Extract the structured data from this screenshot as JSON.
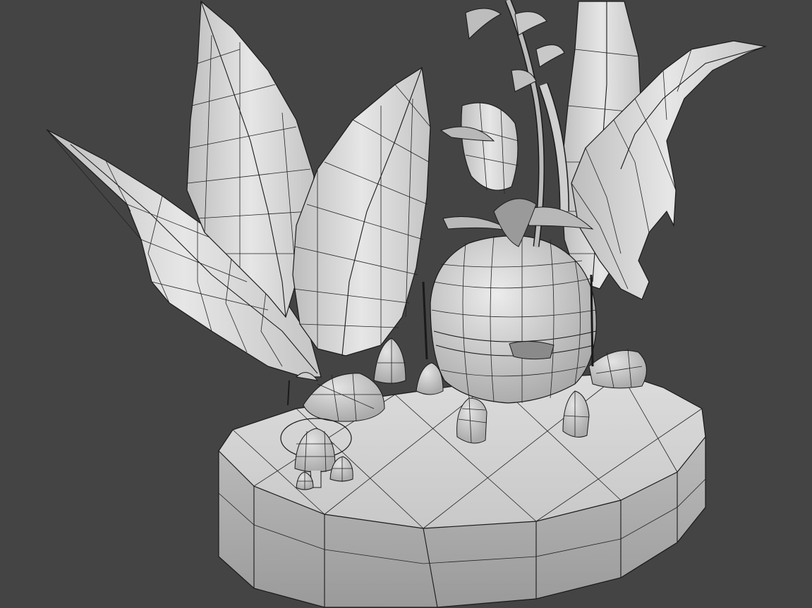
{
  "viewport": {
    "shading_mode": "smooth-shaded-with-wireframe-edges",
    "background_color": "#444444",
    "mesh_color": "#d8d8d8",
    "wire_color": "#1a1a1a"
  },
  "scene": {
    "objects": [
      {
        "name": "oval-base",
        "icon": "mesh"
      },
      {
        "name": "leaf-far-left",
        "icon": "mesh"
      },
      {
        "name": "leaf-back-left",
        "icon": "mesh"
      },
      {
        "name": "leaf-front-mid",
        "icon": "mesh"
      },
      {
        "name": "leaf-back-right",
        "icon": "mesh"
      },
      {
        "name": "leaf-right-curled",
        "icon": "mesh"
      },
      {
        "name": "onion-house-body",
        "icon": "mesh"
      },
      {
        "name": "onion-house-sprout",
        "icon": "mesh"
      },
      {
        "name": "onion-house-legs",
        "icon": "mesh"
      },
      {
        "name": "mushroom-cluster",
        "icon": "mesh"
      },
      {
        "name": "pebbles",
        "icon": "mesh"
      },
      {
        "name": "selection-gizmo-circle",
        "icon": "helper"
      }
    ]
  }
}
